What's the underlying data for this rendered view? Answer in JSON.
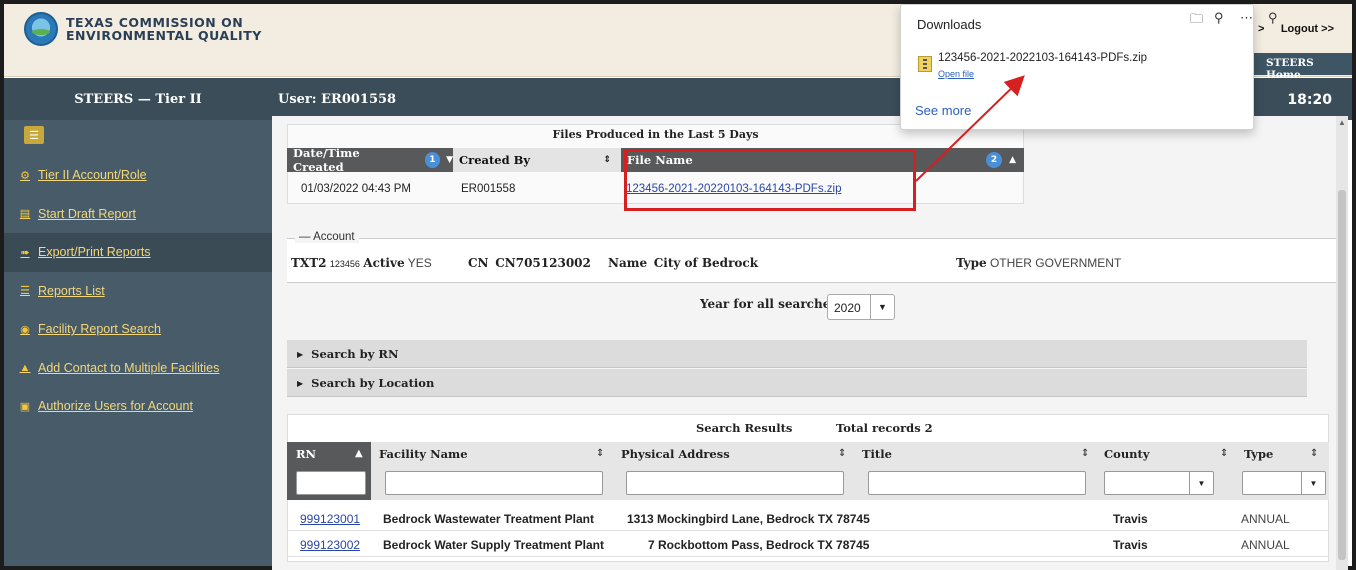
{
  "header": {
    "agency_line1": "TEXAS COMMISSION ON",
    "agency_line2": "ENVIRONMENTAL QUALITY",
    "gt_link": ">",
    "logout": "Logout >>",
    "home": "STEERS Home"
  },
  "sidebar": {
    "title": "STEERS — Tier II",
    "items": [
      {
        "label": "Tier II Account/Role",
        "icon": "gear-icon"
      },
      {
        "label": "Start Draft Report",
        "icon": "id-card-icon"
      },
      {
        "label": "Export/Print Reports",
        "icon": "export-icon"
      },
      {
        "label": "Reports List",
        "icon": "list-icon"
      },
      {
        "label": "Facility Report Search",
        "icon": "binoculars-icon"
      },
      {
        "label": "Add Contact to Multiple Facilities",
        "icon": "person-icon"
      },
      {
        "label": "Authorize Users for Account",
        "icon": "lock-icon"
      }
    ]
  },
  "userbar": {
    "user": "User: ER001558",
    "time": "18:20"
  },
  "files": {
    "title": "Files Produced in the Last 5 Days",
    "columns": [
      "Date/Time Created",
      "Created By",
      "File Name"
    ],
    "badge1": "1",
    "badge2": "2",
    "row": {
      "created": "01/03/2022 04:43 PM",
      "by": "ER001558",
      "file": "123456-2021-20220103-164143-PDFs.zip"
    }
  },
  "account": {
    "legend": "Account",
    "txt_label": "TXT2",
    "txt_id": "123456",
    "active_label": "Active",
    "active_value": "YES",
    "cn_label": "CN",
    "cn_value": "CN705123002",
    "name_label": "Name",
    "name_value": "City of Bedrock",
    "type_label": "Type",
    "type_value": "OTHER GOVERNMENT"
  },
  "year": {
    "label": "Year for all searches",
    "value": "2020"
  },
  "sections": {
    "by_rn": "Search by RN",
    "by_location": "Search by Location"
  },
  "results": {
    "title": "Search Results",
    "total": "Total records 2",
    "columns": [
      "RN",
      "Facility Name",
      "Physical Address",
      "Title",
      "County",
      "Type"
    ],
    "rows": [
      {
        "rn": "999123001",
        "name": "Bedrock Wastewater Treatment Plant",
        "address": "1313 Mockingbird Lane, Bedrock TX 78745",
        "county": "Travis",
        "type": "ANNUAL"
      },
      {
        "rn": "999123002",
        "name": "Bedrock Water Supply Treatment Plant",
        "address": "7 Rockbottom Pass, Bedrock TX 78745",
        "county": "Travis",
        "type": "ANNUAL"
      }
    ]
  },
  "downloads": {
    "title": "Downloads",
    "file": "123456-2021-2022103-164143-PDFs.zip",
    "open": "Open file",
    "see_more": "See more"
  },
  "colors": {
    "accent_red": "#d6201f",
    "sidebar": "#475b68",
    "link_yellow": "#f4d77a"
  }
}
